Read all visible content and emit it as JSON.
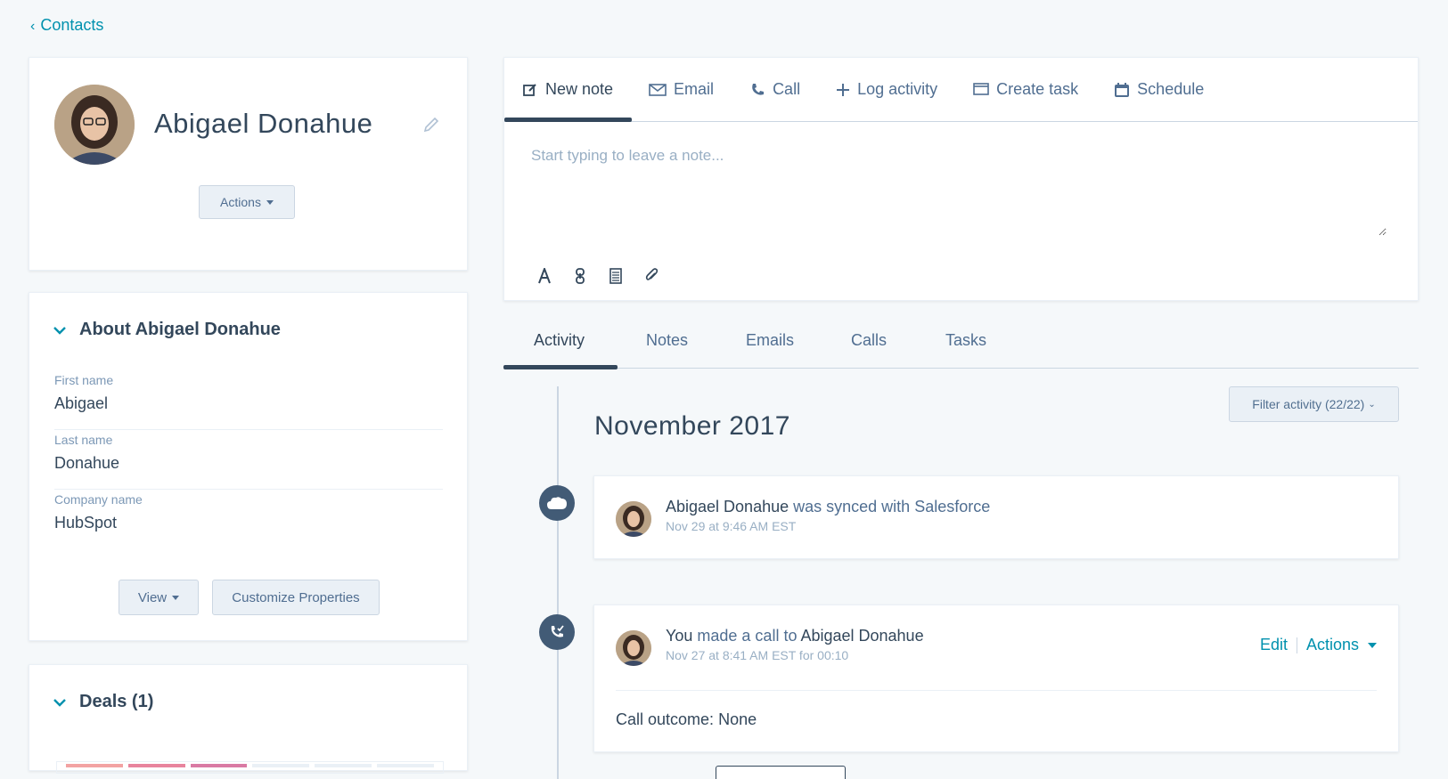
{
  "breadcrumb": {
    "label": "Contacts"
  },
  "contact": {
    "name": "Abigael Donahue",
    "actions_label": "Actions"
  },
  "about": {
    "title": "About Abigael Donahue",
    "fields": [
      {
        "label": "First name",
        "value": "Abigael"
      },
      {
        "label": "Last name",
        "value": "Donahue"
      },
      {
        "label": "Company name",
        "value": "HubSpot"
      }
    ],
    "view_label": "View",
    "customize_label": "Customize Properties"
  },
  "deals": {
    "title": "Deals (1)"
  },
  "composer": {
    "tabs": [
      "New note",
      "Email",
      "Call",
      "Log activity",
      "Create task",
      "Schedule"
    ],
    "placeholder": "Start typing to leave a note..."
  },
  "activity_tabs": [
    "Activity",
    "Notes",
    "Emails",
    "Calls",
    "Tasks"
  ],
  "filter_label": "Filter activity (22/22)",
  "month": "November 2017",
  "events": [
    {
      "actor": "Abigael Donahue",
      "action": "was synced with Salesforce",
      "time": "Nov 29 at 9:46 AM EST"
    },
    {
      "actor": "You",
      "action": "made a call to",
      "target": "Abigael Donahue",
      "time": "Nov 27 at 8:41 AM EST for 00:10",
      "edit_label": "Edit",
      "actions_label": "Actions",
      "outcome_label": "Call outcome:",
      "outcome_value": "None"
    }
  ],
  "colors": {
    "accent": "#0091ae",
    "dark": "#33475b",
    "timeline_icon": "#425b76"
  }
}
